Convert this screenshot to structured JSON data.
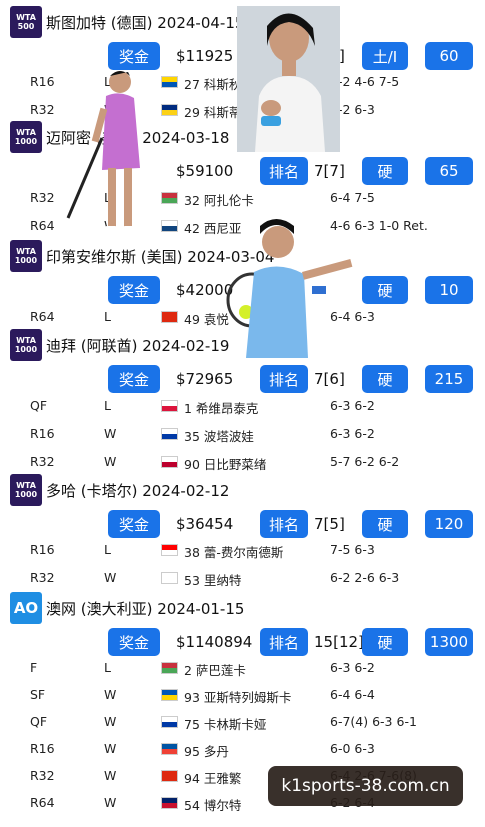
{
  "tournaments": [
    {
      "logo": "WTA 500",
      "title": "斯图加特 (德国) 2024-04-15",
      "prize_label": "奖金",
      "prize": "$11925",
      "rank_label": "",
      "seed": "7[5]",
      "surface": "土/I",
      "points": "60",
      "matches": [
        {
          "round": "R16",
          "result": "L",
          "opponent": "27 科斯秋克",
          "score": "6-2 4-6 7-5"
        },
        {
          "round": "R32",
          "result": "W",
          "opponent": "29 科斯蒂",
          "score": "6-2 6-3"
        }
      ]
    },
    {
      "logo": "WTA 1000",
      "title": "迈阿密 (美国) 2024-03-18",
      "prize_label": "",
      "prize": "$59100",
      "rank_label": "排名",
      "seed": "7[7]",
      "surface": "硬",
      "points": "65",
      "matches": [
        {
          "round": "R32",
          "result": "L",
          "opponent": "32 阿扎伦卡",
          "score": "6-4 7-5"
        },
        {
          "round": "R64",
          "result": "W",
          "opponent": "42 西尼亚",
          "score": "4-6 6-3 1-0 Ret."
        }
      ]
    },
    {
      "logo": "WTA 1000",
      "title": "印第安维尔斯 (美国) 2024-03-04",
      "prize_label": "奖金",
      "prize": "$42000",
      "rank_label": "",
      "seed": "",
      "surface": "硬",
      "points": "10",
      "matches": [
        {
          "round": "R64",
          "result": "L",
          "opponent": "49 袁悦",
          "score": "6-4 6-3"
        }
      ]
    },
    {
      "logo": "WTA 1000",
      "title": "迪拜 (阿联酋) 2024-02-19",
      "prize_label": "奖金",
      "prize": "$72965",
      "rank_label": "排名",
      "seed": "7[6]",
      "surface": "硬",
      "points": "215",
      "matches": [
        {
          "round": "QF",
          "result": "L",
          "opponent": "1 希维昂泰克",
          "score": "6-3 6-2"
        },
        {
          "round": "R16",
          "result": "W",
          "opponent": "35 波塔波娃",
          "score": "6-3 6-2"
        },
        {
          "round": "R32",
          "result": "W",
          "opponent": "90 日比野菜绪",
          "score": "5-7 6-2 6-2"
        }
      ]
    },
    {
      "logo": "WTA 1000",
      "title": "多哈 (卡塔尔) 2024-02-12",
      "prize_label": "奖金",
      "prize": "$36454",
      "rank_label": "排名",
      "seed": "7[5]",
      "surface": "硬",
      "points": "120",
      "matches": [
        {
          "round": "R16",
          "result": "L",
          "opponent": "38 蕾-费尔南德斯",
          "score": "7-5 6-3"
        },
        {
          "round": "R32",
          "result": "W",
          "opponent": "53 里纳特",
          "score": "6-2 2-6 6-3"
        }
      ]
    },
    {
      "logo": "AO",
      "title": "澳网 (澳大利亚) 2024-01-15",
      "prize_label": "奖金",
      "prize": "$1140894",
      "rank_label": "排名",
      "seed": "15[12]",
      "surface": "硬",
      "points": "1300",
      "matches": [
        {
          "round": "F",
          "result": "L",
          "opponent": "2 萨巴莲卡",
          "score": "6-3 6-2"
        },
        {
          "round": "SF",
          "result": "W",
          "opponent": "93 亚斯特列姆斯卡",
          "score": "6-4 6-4"
        },
        {
          "round": "QF",
          "result": "W",
          "opponent": "75 卡林斯卡娅",
          "score": "6-7(4) 6-3 6-1"
        },
        {
          "round": "R16",
          "result": "W",
          "opponent": "95 多丹",
          "score": "6-0 6-3"
        },
        {
          "round": "R32",
          "result": "W",
          "opponent": "94 王雅繁",
          "score": "6-4 2-6 7-6(8)"
        },
        {
          "round": "R64",
          "result": "W",
          "opponent": "54 博尔特",
          "score": "6-2 6-4"
        }
      ]
    }
  ],
  "watermark": "k1sports-38.com.cn"
}
